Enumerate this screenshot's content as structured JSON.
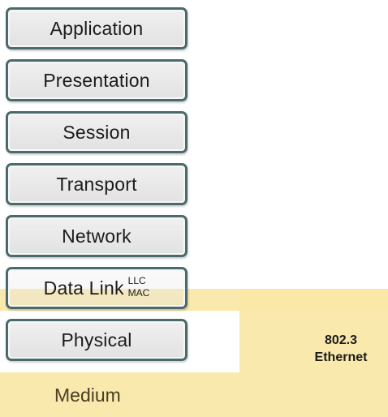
{
  "layers": {
    "application": "Application",
    "presentation": "Presentation",
    "session": "Session",
    "transport": "Transport",
    "network": "Network",
    "data_link": "Data Link",
    "data_link_sublayers": [
      "LLC",
      "MAC"
    ],
    "physical": "Physical"
  },
  "medium": "Medium",
  "standard": {
    "line1": "802.3",
    "line2": "Ethernet"
  },
  "colors": {
    "highlight": "#f8e7a5",
    "box_border": "#4a6a6c",
    "box_fill": "#e9e9e9"
  }
}
